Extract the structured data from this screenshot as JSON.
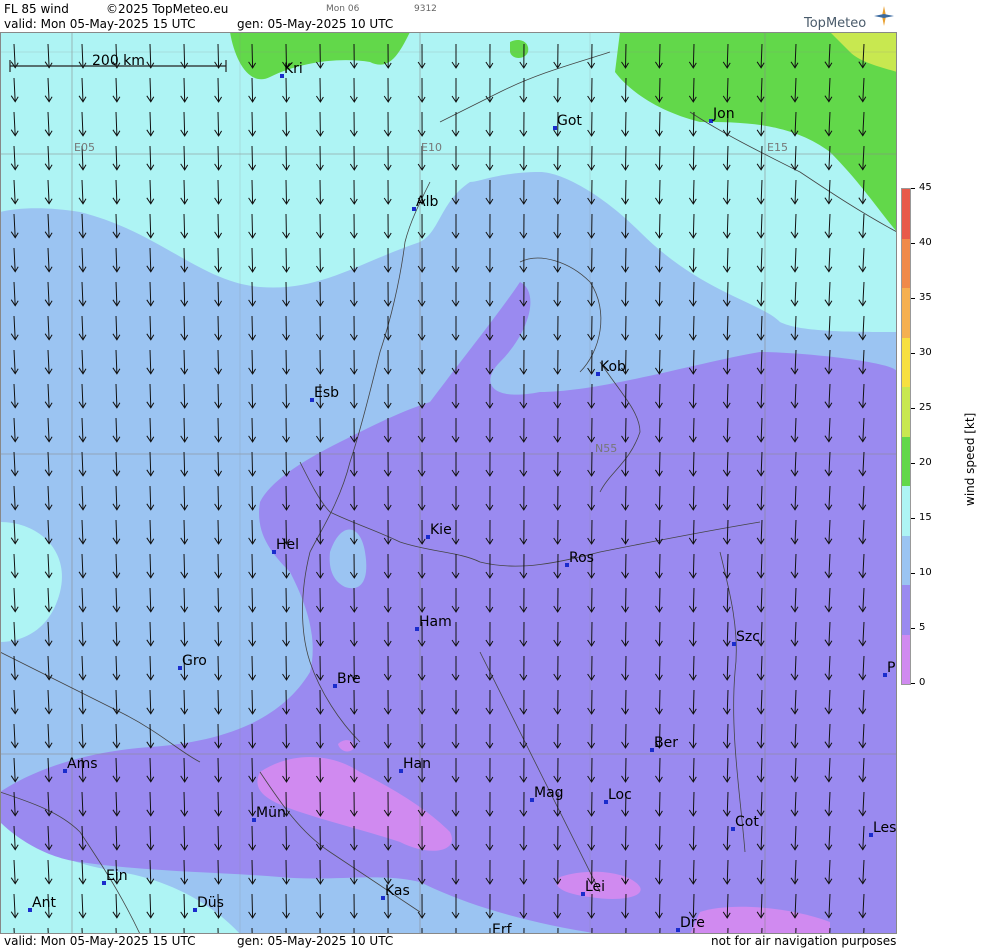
{
  "header": {
    "product": "FL 85 wind",
    "copyright": "©2025 TopMeteo.eu",
    "valid": "valid:  Mon  05-May-2025  15 UTC",
    "gen": "gen: 05-May-2025 10 UTC",
    "day_tab": "Mon 06",
    "code": "9312",
    "brand": "TopMeteo"
  },
  "footer": {
    "valid": "valid:  Mon  05-May-2025  15 UTC",
    "gen": "gen: 05-May-2025 10 UTC",
    "disclaimer": "not for air navigation purposes"
  },
  "map": {
    "scale_label": "200 km",
    "grid_labels": [
      "E05",
      "E10",
      "E15",
      "N55"
    ],
    "cities": [
      "Kri",
      "Got",
      "Jon",
      "Alb",
      "Kob",
      "Esb",
      "Kie",
      "Hel",
      "Ros",
      "Ham",
      "Szc",
      "Gro",
      "Bre",
      "P",
      "Ber",
      "Ams",
      "Han",
      "Mag",
      "Loc",
      "Mün",
      "Cot",
      "Les",
      "Ein",
      "Kas",
      "Lei",
      "Ant",
      "Düs",
      "Dre",
      "Erf"
    ]
  },
  "legend": {
    "title": "wind speed [kt]",
    "ticks": [
      "45",
      "40",
      "35",
      "30",
      "25",
      "20",
      "15",
      "10",
      "5",
      "0"
    ],
    "colors": [
      "#e85a4a",
      "#f08a4a",
      "#f5b050",
      "#f7e040",
      "#c8e850",
      "#62d84a",
      "#aef4f4",
      "#9bc4f2",
      "#9a8af0",
      "#d08af0"
    ]
  }
}
